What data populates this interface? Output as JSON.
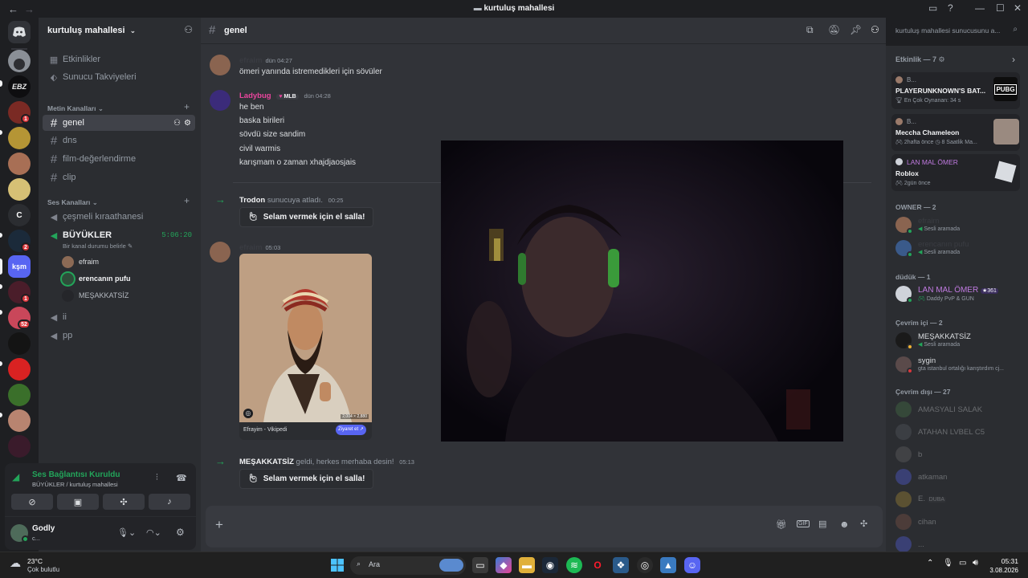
{
  "window": {
    "title": "kurtuluş mahallesi"
  },
  "servers": [
    {
      "name": "server-avatar-1",
      "badge": ""
    },
    {
      "name": "server-ebz",
      "label": "EBZ",
      "badge": ""
    },
    {
      "name": "server-avatar-3",
      "badge": "1"
    },
    {
      "name": "server-avatar-4",
      "badge": ""
    },
    {
      "name": "server-avatar-5",
      "badge": ""
    },
    {
      "name": "server-avatar-6",
      "badge": ""
    },
    {
      "name": "server-c",
      "label": "C",
      "badge": ""
    },
    {
      "name": "server-avatar-8",
      "badge": "2"
    },
    {
      "name": "server-ksm",
      "label": "kşm",
      "badge": ""
    },
    {
      "name": "server-avatar-10",
      "badge": "1"
    },
    {
      "name": "server-avatar-11",
      "badge": "52"
    }
  ],
  "guild": {
    "name": "kurtuluş mahallesi"
  },
  "nav": {
    "events": "Etkinlikler",
    "boosts": "Sunucu Takviyeleri"
  },
  "text_category": "Metin Kanalları",
  "text_channels": [
    {
      "label": "genel"
    },
    {
      "label": "dns"
    },
    {
      "label": "film-değerlendirme"
    },
    {
      "label": "clip"
    }
  ],
  "voice_category": "Ses Kanalları",
  "voice_channels": {
    "c1": "çeşmeli kıraathanesi",
    "c2": "BÜYÜKLER",
    "c2_timer": "5:06:20",
    "c2_status": "Bir kanal durumu belirle",
    "users": [
      "efraim",
      "erencanın pufu",
      "MEŞAKKATSİZ"
    ],
    "c3": "ii",
    "c4": "pp"
  },
  "voice_panel": {
    "status": "Ses Bağlantısı Kuruldu",
    "location": "BÜYÜKLER / kurtuluş mahallesi"
  },
  "user_panel": {
    "name": "Godly",
    "sub": "c..."
  },
  "header": {
    "channel": "genel",
    "search_placeholder": "kurtuluş mahallesi sunucusunu a..."
  },
  "messages": {
    "m1": {
      "author": "efraim",
      "time": "dün 04:27",
      "text": "ömeri yanında istremedikleri için sövüler"
    },
    "m2": {
      "author": "Ladybug",
      "tag": "MLB",
      "time": "dün 04:28",
      "lines": [
        "he ben",
        "baska birileri",
        "sövdü size sandim",
        "civil warmis",
        "karışmam o zaman xhajdjaosjais"
      ]
    },
    "s1": {
      "user": "Trodon",
      "text": "sunucuya atladı.",
      "time": "00:25",
      "wave": "Selam vermek için el salla!"
    },
    "m3": {
      "author": "efraim",
      "time": "05:03",
      "embed_title": "Efrayim - Vikipedi",
      "embed_btn": "Ziyaret et",
      "embed_size": "2,004 × 2,880"
    },
    "s2": {
      "user": "MEŞAKKATSİZ",
      "text": "geldi, herkes merhaba desin!",
      "time": "05:13",
      "wave": "Selam vermek için el salla!"
    }
  },
  "members": {
    "activity_header": "Etkinlik — 7",
    "activities": [
      {
        "user": "B...",
        "game": "PLAYERUNKNOWN'S BAT...",
        "meta": "En Çok Oynanan: 34 s",
        "thumb": "PUBG"
      },
      {
        "user": "B...",
        "game": "Meccha Chameleon",
        "meta": "2hafta önce",
        "meta2": "8 Saatlik Ma..."
      },
      {
        "user": "LAN MAL ÖMER",
        "game": "Roblox",
        "meta": "2gün önce"
      }
    ],
    "owner_header": "OWNER — 2",
    "owners": [
      {
        "name": "efraim",
        "sub": "Sesli aramada"
      },
      {
        "name": "erencanın pufu",
        "sub": "Sesli aramada"
      }
    ],
    "duduk_header": "düdük — 1",
    "duduk": [
      {
        "name": "LAN MAL ÖMER",
        "badge": "361",
        "sub": "Daddy PvP & GUN"
      }
    ],
    "online_header": "Çevrim içi — 2",
    "online": [
      {
        "name": "MEŞAKKATSİZ",
        "sub": "Sesli aramada"
      },
      {
        "name": "sygin",
        "sub": "gta istanbul ortalığı karıştırdım cj..."
      }
    ],
    "offline_header": "Çevrim dışı — 27",
    "offline": [
      {
        "name": "AMASYALI SALAK"
      },
      {
        "name": "ATAHAN LVBEL C5"
      },
      {
        "name": "b"
      },
      {
        "name": "atkaman"
      },
      {
        "name": "E.",
        "badge": "DUBA"
      },
      {
        "name": "cihan"
      },
      {
        "name": "..."
      }
    ]
  },
  "taskbar": {
    "weather_temp": "23°C",
    "weather_desc": "Çok bulutlu",
    "search": "Ara",
    "time": "05:31",
    "date": "3.08.2026"
  },
  "colors": {
    "accent": "#5865f2",
    "online": "#23a55a",
    "ladybug": "#f47fff",
    "pink_name": "#eb459e"
  }
}
